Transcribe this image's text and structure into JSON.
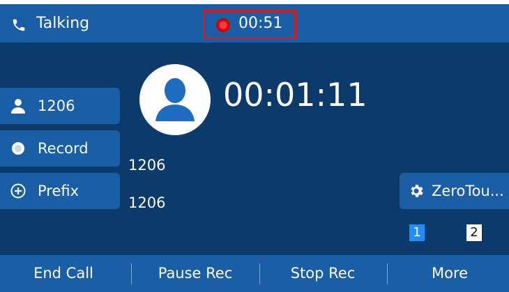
{
  "status_bar": {
    "icon": "phone-handset-icon",
    "state_label": "Talking",
    "recording": {
      "icon": "recording-dot-icon",
      "time": "00:51",
      "highlight_color": "#e01818"
    }
  },
  "side_keys": [
    {
      "icon": "contact-person-icon",
      "label": "1206"
    },
    {
      "icon": "record-radio-icon",
      "label": "Record"
    },
    {
      "icon": "plus-circle-icon",
      "label": "Prefix"
    }
  ],
  "call": {
    "avatar_icon": "caller-avatar-icon",
    "duration": "00:01:11",
    "name": "1206",
    "number": "1206"
  },
  "right_key": {
    "icon": "gear-icon",
    "label": "ZeroTou..."
  },
  "pages": {
    "current": "1",
    "other": "2"
  },
  "softkeys": [
    "End Call",
    "Pause Rec",
    "Stop Rec",
    "More"
  ],
  "colors": {
    "background": "#0c3a6b",
    "bar": "#1a5ea6",
    "page_active": "#1f8fff"
  }
}
